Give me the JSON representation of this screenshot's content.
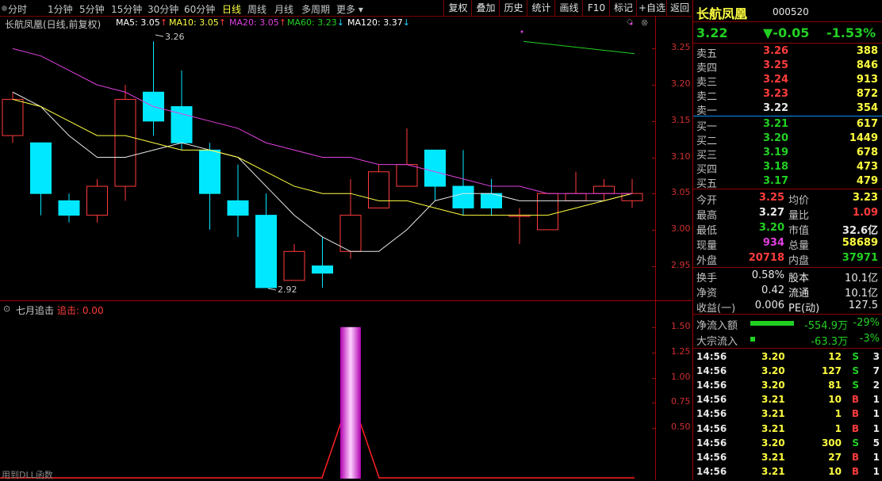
{
  "toolbar": {
    "periods": [
      "分时",
      "1分钟",
      "5分钟",
      "15分钟",
      "30分钟",
      "60分钟",
      "日线",
      "周线",
      "月线",
      "多周期",
      "更多"
    ],
    "active_period": "日线",
    "buttons": [
      "复权",
      "叠加",
      "历史",
      "统计",
      "画线",
      "F10",
      "标记",
      "+自选",
      "返回"
    ]
  },
  "main_chart": {
    "title": "长航凤凰(日线,前复权)",
    "ma_labels": [
      {
        "name": "MA5: 3.05",
        "arrow": "↑",
        "color": "#ffffff"
      },
      {
        "name": "MA10: 3.05",
        "arrow": "↑",
        "color": "#ffff40"
      },
      {
        "name": "MA20: 3.05",
        "arrow": "↑",
        "color": "#e040e0"
      },
      {
        "name": "MA60: 3.23",
        "arrow": "↓",
        "color": "#22d022"
      },
      {
        "name": "MA120: 3.37",
        "arrow": "↓",
        "color": "#ffffff"
      }
    ],
    "high_marker": "3.26",
    "low_marker": "2.92",
    "y_ticks": [
      "3.25",
      "3.20",
      "3.15",
      "3.10",
      "3.05",
      "3.00",
      "2.95"
    ]
  },
  "chart_data": {
    "type": "candlestick",
    "ylim": [
      2.92,
      3.28
    ],
    "candles": [
      {
        "o": 3.13,
        "c": 3.18,
        "h": 3.19,
        "l": 3.12
      },
      {
        "o": 3.12,
        "c": 3.05,
        "h": 3.12,
        "l": 3.02
      },
      {
        "o": 3.04,
        "c": 3.02,
        "h": 3.05,
        "l": 3.01
      },
      {
        "o": 3.02,
        "c": 3.06,
        "h": 3.07,
        "l": 3.01
      },
      {
        "o": 3.06,
        "c": 3.18,
        "h": 3.2,
        "l": 3.04
      },
      {
        "o": 3.19,
        "c": 3.15,
        "h": 3.26,
        "l": 3.13
      },
      {
        "o": 3.17,
        "c": 3.12,
        "h": 3.22,
        "l": 3.11
      },
      {
        "o": 3.11,
        "c": 3.05,
        "h": 3.12,
        "l": 3.0
      },
      {
        "o": 3.04,
        "c": 3.02,
        "h": 3.09,
        "l": 2.99
      },
      {
        "o": 3.02,
        "c": 2.92,
        "h": 3.05,
        "l": 2.92
      },
      {
        "o": 2.93,
        "c": 2.97,
        "h": 2.98,
        "l": 2.93
      },
      {
        "o": 2.95,
        "c": 2.94,
        "h": 2.99,
        "l": 2.92
      },
      {
        "o": 2.97,
        "c": 3.02,
        "h": 3.07,
        "l": 2.96
      },
      {
        "o": 3.03,
        "c": 3.08,
        "h": 3.09,
        "l": 3.03
      },
      {
        "o": 3.06,
        "c": 3.09,
        "h": 3.14,
        "l": 3.06
      },
      {
        "o": 3.11,
        "c": 3.06,
        "h": 3.11,
        "l": 3.04
      },
      {
        "o": 3.06,
        "c": 3.03,
        "h": 3.11,
        "l": 3.02
      },
      {
        "o": 3.05,
        "c": 3.03,
        "h": 3.07,
        "l": 3.02
      },
      {
        "o": 3.02,
        "c": 3.02,
        "h": 3.03,
        "l": 2.98
      },
      {
        "o": 3.0,
        "c": 3.05,
        "h": 3.05,
        "l": 3.0
      },
      {
        "o": 3.04,
        "c": 3.05,
        "h": 3.08,
        "l": 3.04
      },
      {
        "o": 3.05,
        "c": 3.06,
        "h": 3.07,
        "l": 3.04
      },
      {
        "o": 3.04,
        "c": 3.05,
        "h": 3.07,
        "l": 3.03
      }
    ],
    "series": [
      {
        "name": "MA5",
        "color": "#e8e8e8",
        "values": [
          3.19,
          3.17,
          3.13,
          3.1,
          3.1,
          3.11,
          3.12,
          3.11,
          3.1,
          3.06,
          3.02,
          2.99,
          2.97,
          2.97,
          3.0,
          3.04,
          3.05,
          3.05,
          3.04,
          3.04,
          3.04,
          3.04,
          3.05
        ]
      },
      {
        "name": "MA10",
        "color": "#ffff40",
        "values": [
          3.18,
          3.17,
          3.15,
          3.13,
          3.13,
          3.12,
          3.11,
          3.11,
          3.1,
          3.08,
          3.06,
          3.05,
          3.05,
          3.04,
          3.04,
          3.03,
          3.02,
          3.02,
          3.02,
          3.02,
          3.03,
          3.04,
          3.05
        ]
      },
      {
        "name": "MA20",
        "color": "#e040e0",
        "values": [
          3.25,
          3.24,
          3.22,
          3.2,
          3.19,
          3.17,
          3.16,
          3.15,
          3.14,
          3.12,
          3.11,
          3.1,
          3.1,
          3.09,
          3.09,
          3.08,
          3.07,
          3.06,
          3.06,
          3.05,
          3.05,
          3.05,
          3.05
        ]
      }
    ],
    "ma60_segment": {
      "color": "#22d022",
      "from": 3.26,
      "to": 3.23
    }
  },
  "indicator": {
    "title": "七月追击",
    "label": "追击: 0.00",
    "y_ticks": [
      "1.50",
      "1.25",
      "1.00",
      "0.75",
      "0.50"
    ],
    "ylim": [
      0,
      1.6
    ],
    "spike_index": 12,
    "spike_value": 1.5,
    "footer": "用到DLL函数"
  },
  "quote": {
    "name": "长航凤凰",
    "code": "000520",
    "price": "3.22",
    "change": "▼-0.05",
    "change_pct": "-1.53%",
    "asks": [
      {
        "label": "卖五",
        "price": "3.26",
        "vol": "388"
      },
      {
        "label": "卖四",
        "price": "3.25",
        "vol": "846"
      },
      {
        "label": "卖三",
        "price": "3.24",
        "vol": "913"
      },
      {
        "label": "卖二",
        "price": "3.23",
        "vol": "872"
      },
      {
        "label": "卖一",
        "price": "3.22",
        "vol": "354"
      }
    ],
    "bids": [
      {
        "label": "买一",
        "price": "3.21",
        "vol": "617"
      },
      {
        "label": "买二",
        "price": "3.20",
        "vol": "1449"
      },
      {
        "label": "买三",
        "price": "3.19",
        "vol": "678"
      },
      {
        "label": "买四",
        "price": "3.18",
        "vol": "473"
      },
      {
        "label": "买五",
        "price": "3.17",
        "vol": "479"
      }
    ],
    "stats": [
      {
        "l1": "今开",
        "v1": "3.25",
        "c1": "red",
        "l2": "均价",
        "v2": "3.23",
        "c2": "yellow"
      },
      {
        "l1": "最高",
        "v1": "3.27",
        "c1": "white",
        "l2": "量比",
        "v2": "1.09",
        "c2": "red"
      },
      {
        "l1": "最低",
        "v1": "3.20",
        "c1": "green",
        "l2": "市值",
        "v2": "32.6亿",
        "c2": "white"
      },
      {
        "l1": "现量",
        "v1": "934",
        "c1": "purple",
        "l2": "总量",
        "v2": "58689",
        "c2": "yellow"
      },
      {
        "l1": "外盘",
        "v1": "20718",
        "c1": "red",
        "l2": "内盘",
        "v2": "37971",
        "c2": "green"
      }
    ],
    "stats2": [
      {
        "l1": "换手",
        "v1": "0.58%",
        "l2": "股本",
        "v2": "10.1亿"
      },
      {
        "l1": "净资",
        "v1": "0.42",
        "l2": "流通",
        "v2": "10.1亿"
      },
      {
        "l1": "收益(一)",
        "v1": "0.006",
        "l2": "PE(动)",
        "v2": "127.5"
      }
    ],
    "flows": [
      {
        "label": "净流入额",
        "value": "-554.9万",
        "pct": "-29%",
        "fill": 0.29
      },
      {
        "label": "大宗流入",
        "value": "-63.3万",
        "pct": "-3%",
        "fill": 0.03
      }
    ],
    "ticks": [
      {
        "time": "14:56",
        "price": "3.20",
        "pcolor": "yellow",
        "vol": "12",
        "side": "S",
        "n": "3"
      },
      {
        "time": "14:56",
        "price": "3.20",
        "pcolor": "yellow",
        "vol": "127",
        "side": "S",
        "n": "7"
      },
      {
        "time": "14:56",
        "price": "3.20",
        "pcolor": "yellow",
        "vol": "81",
        "side": "S",
        "n": "2"
      },
      {
        "time": "14:56",
        "price": "3.21",
        "pcolor": "yellow",
        "vol": "10",
        "side": "B",
        "n": "1"
      },
      {
        "time": "14:56",
        "price": "3.21",
        "pcolor": "yellow",
        "vol": "1",
        "side": "B",
        "n": "1"
      },
      {
        "time": "14:56",
        "price": "3.21",
        "pcolor": "yellow",
        "vol": "1",
        "side": "B",
        "n": "1"
      },
      {
        "time": "14:56",
        "price": "3.20",
        "pcolor": "yellow",
        "vol": "300",
        "side": "S",
        "n": "5"
      },
      {
        "time": "14:56",
        "price": "3.21",
        "pcolor": "yellow",
        "vol": "27",
        "side": "B",
        "n": "1"
      },
      {
        "time": "14:56",
        "price": "3.21",
        "pcolor": "yellow",
        "vol": "10",
        "side": "B",
        "n": "1"
      }
    ]
  }
}
